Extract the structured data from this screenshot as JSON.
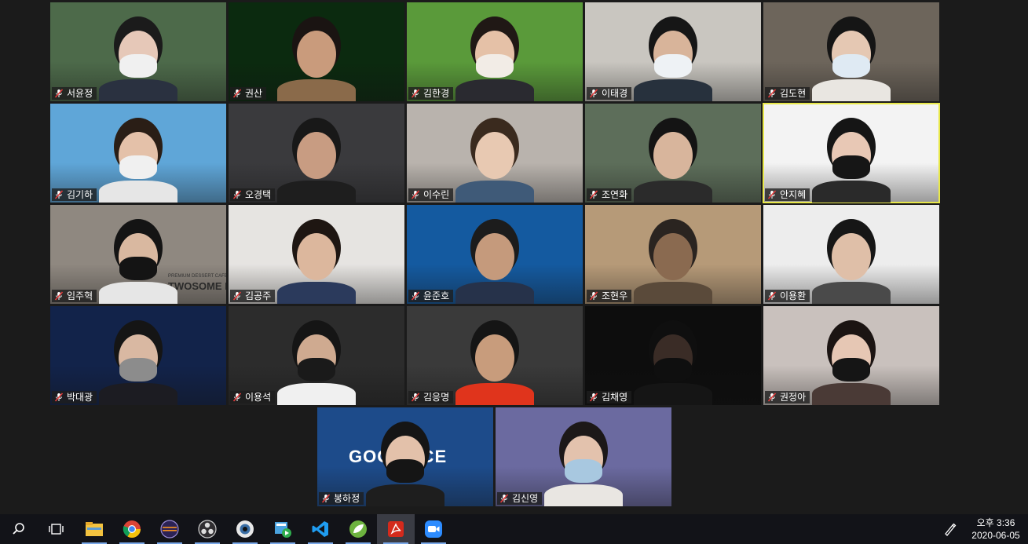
{
  "participants": [
    {
      "name": "서윤정",
      "bg": "#4d6a4a",
      "skin": "#e6c8b8",
      "hair": "#1b1b1b",
      "shirt": "#2a3140",
      "mask": "#f0f0f0"
    },
    {
      "name": "권산",
      "bg": "#0b2a0f",
      "skin": "#c99b7c",
      "hair": "#1a1412",
      "shirt": "#8a6a4a",
      "mask": ""
    },
    {
      "name": "김한경",
      "bg": "#5a9a3a",
      "skin": "#e5c1a7",
      "hair": "#201815",
      "shirt": "#2a2a30",
      "mask": "#f2ece6"
    },
    {
      "name": "이태경",
      "bg": "#c9c6c0",
      "skin": "#d8b49a",
      "hair": "#161616",
      "shirt": "#27313d",
      "mask": "#eef2f5"
    },
    {
      "name": "김도현",
      "bg": "#6d655b",
      "skin": "#e5c8b3",
      "hair": "#151515",
      "shirt": "#e9e6e1",
      "mask": "#dfeaf3"
    },
    {
      "name": "김기하",
      "bg": "#5fa6d8",
      "skin": "#e4c1a9",
      "hair": "#2a1e16",
      "shirt": "#e6e6e6",
      "mask": "#f0f0f0"
    },
    {
      "name": "오경택",
      "bg": "#3a3a3d",
      "skin": "#c89c82",
      "hair": "#181818",
      "shirt": "#1e1e1e",
      "mask": ""
    },
    {
      "name": "이수린",
      "bg": "#b9b3ad",
      "skin": "#e8c9b2",
      "hair": "#3a2a1e",
      "shirt": "#3f5a78",
      "mask": ""
    },
    {
      "name": "조연화",
      "bg": "#5d6e5a",
      "skin": "#d8b59c",
      "hair": "#141414",
      "shirt": "#2b2b2b",
      "mask": ""
    },
    {
      "name": "안지혜",
      "bg": "#f3f3f3",
      "skin": "#e8c8b5",
      "hair": "#151515",
      "shirt": "#2a2a2a",
      "mask": "#161616"
    },
    {
      "name": "임주혁",
      "bg": "#8f8880",
      "skin": "#d9b8a0",
      "hair": "#141414",
      "shirt": "#e6e6e6",
      "mask": "#141414"
    },
    {
      "name": "김공주",
      "bg": "#e6e4e1",
      "skin": "#dcb79d",
      "hair": "#1e1612",
      "shirt": "#2b3a5c",
      "mask": ""
    },
    {
      "name": "윤준호",
      "bg": "#145aa0",
      "skin": "#c59a7c",
      "hair": "#1c1c1c",
      "shirt": "#26324a",
      "mask": ""
    },
    {
      "name": "조현우",
      "bg": "#b69a78",
      "skin": "#8a6a50",
      "hair": "#2a2420",
      "shirt": "#5a4a3a",
      "mask": ""
    },
    {
      "name": "이용환",
      "bg": "#ededed",
      "skin": "#dfbfa8",
      "hair": "#161616",
      "shirt": "#4a4a4a",
      "mask": ""
    },
    {
      "name": "박대광",
      "bg": "#12234a",
      "skin": "#d9b8a2",
      "hair": "#151515",
      "shirt": "#1c1c22",
      "mask": "#8c8c8c"
    },
    {
      "name": "이용석",
      "bg": "#2c2c2c",
      "skin": "#cfaa90",
      "hair": "#151515",
      "shirt": "#f0f0f0",
      "mask": "#1a1a1a"
    },
    {
      "name": "김응명",
      "bg": "#3a3a3a",
      "skin": "#c89c7c",
      "hair": "#151515",
      "shirt": "#e0341c",
      "mask": ""
    },
    {
      "name": "김채영",
      "bg": "#0d0d0d",
      "skin": "#3a2c26",
      "hair": "#0f0f0f",
      "shirt": "#151515",
      "mask": "#0f0f0f"
    },
    {
      "name": "권정아",
      "bg": "#c9c1bd",
      "skin": "#e6c7b4",
      "hair": "#1b1412",
      "shirt": "#4a3a36",
      "mask": "#151515"
    },
    {
      "name": "봉하정",
      "bg": "#1d4b8a",
      "skin": "#e3c1aa",
      "hair": "#151515",
      "shirt": "#1e1e1e",
      "mask": "#151515"
    },
    {
      "name": "김신영",
      "bg": "#6b6aa0",
      "skin": "#e3c2ad",
      "hair": "#1c1818",
      "shirt": "#e9e6e2",
      "mask": "#a8c8e0"
    }
  ],
  "backdrop_text": {
    "tile_11": "TWOSOME PL",
    "tile_11_small": "PREMIUM DESSERT CAFE",
    "tile_21": "GOOD   CE"
  },
  "active_speaker": "안지혜",
  "taskbar": {
    "apps": [
      "search-icon",
      "task-view-icon",
      "file-explorer-icon",
      "chrome-icon",
      "eclipse-icon",
      "obs-icon",
      "webcam-app-icon",
      "media-player-icon",
      "vscode-icon",
      "spring-tool-icon",
      "acrobat-icon",
      "zoom-icon"
    ],
    "clock_time": "오후 3:36",
    "clock_date": "2020-06-05"
  }
}
